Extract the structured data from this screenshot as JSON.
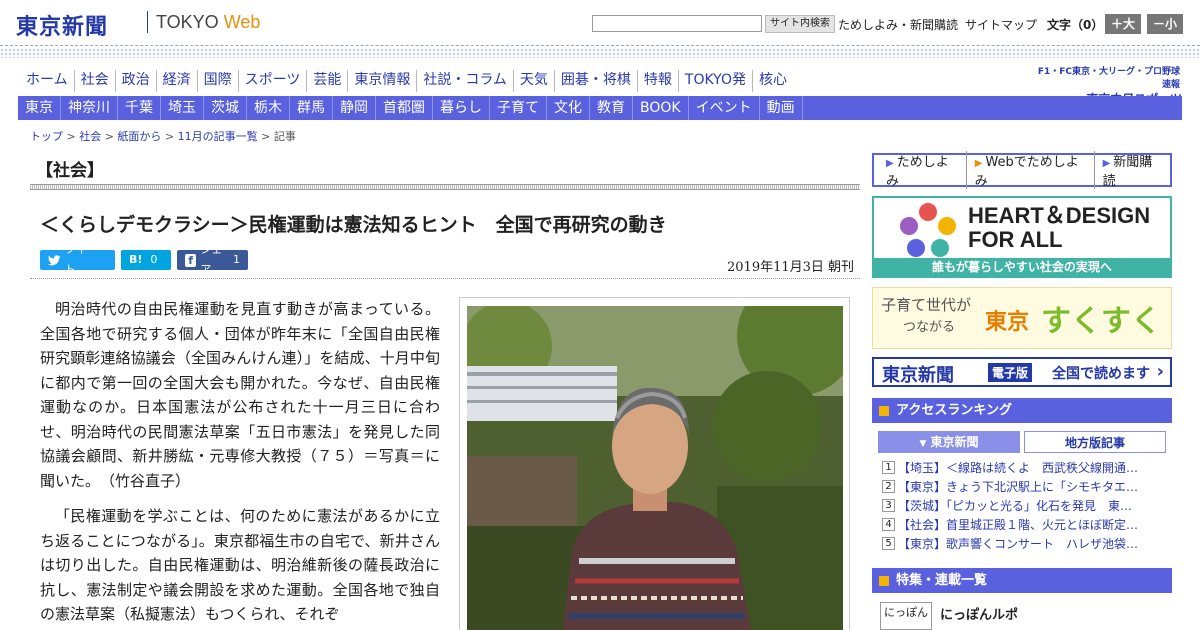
{
  "header": {
    "logo_jp": "東京新聞",
    "logo_en_tokyo": "TOKYO",
    "logo_en_web": "Web",
    "search_button": "サイト内検索",
    "search_value": "",
    "link_tameshi": "ためしよみ・新聞購読",
    "link_sitemap": "サイトマップ",
    "font_size_label": "文字（0）",
    "font_plus": "＋大",
    "font_minus": "－小"
  },
  "main_nav": [
    "ホーム",
    "社会",
    "政治",
    "経済",
    "国際",
    "スポーツ",
    "芸能",
    "東京情報",
    "社説・コラム",
    "天気",
    "囲碁・将棋",
    "特報",
    "TOKYO発",
    "核心"
  ],
  "chunichi": {
    "top": "F1・FC東京・大リーグ・プロ野球速報",
    "brand": "東京中日スポーツ"
  },
  "region_nav": [
    "東京",
    "神奈川",
    "千葉",
    "埼玉",
    "茨城",
    "栃木",
    "群馬",
    "静岡",
    "首都圏",
    "暮らし",
    "子育て",
    "文化",
    "教育",
    "BOOK",
    "イベント",
    "動画"
  ],
  "breadcrumb": [
    "トップ",
    "社会",
    "紙面から",
    "11月の記事一覧",
    "記事"
  ],
  "breadcrumb_sep": ">",
  "article": {
    "section": "【社会】",
    "title": "＜くらしデモクラシー＞民権運動は憲法知るヒント　全国で再研究の動き",
    "share_tweet": "ツイート",
    "share_hatena_logo": "B!",
    "share_hatena_count": "0",
    "share_fb_label": "シェア",
    "share_fb_count": "1",
    "date": "2019年11月3日 朝刊",
    "paragraphs": [
      "明治時代の自由民権運動を見直す動きが高まっている。全国各地で研究する個人・団体が昨年末に「全国自由民権研究顕彰連絡協議会（全国みんけん連）」を結成、十月中旬に都内で第一回の全国大会も開かれた。今なぜ、自由民権運動なのか。日本国憲法が公布された十一月三日に合わせ、明治時代の民間憲法草案「五日市憲法」を発見した同協議会顧問、新井勝紘・元専修大教授（７５）＝写真＝に聞いた。　（竹谷直子）",
      "「民権運動を学ぶことは、何のために憲法があるかに立ち返ることにつながる」。東京都福生市の自宅で、新井さんは切り出した。自由民権運動は、明治維新後の薩長政治に抗し、憲法制定や議会開設を求めた運動。全国各地で独自の憲法草案（私擬憲法）もつくられ、それぞ"
    ]
  },
  "sidebar": {
    "tameshi": [
      "ためしよみ",
      "Webでためしよみ",
      "新聞購読"
    ],
    "heart_design_line1": "HEART＆DESIGN",
    "heart_design_line2": "FOR ALL",
    "heart_design_sub": "誰もが暮らしやすい社会の実現へ",
    "sukusuku_1": "子育て世代が",
    "sukusuku_2": "つながる",
    "sukusuku_3": "東京",
    "sukusuku_4": "すくすく",
    "denshiban_1": "東京新聞",
    "denshiban_2": "電子版",
    "denshiban_3": "全国で読めます",
    "ranking_title": "アクセスランキング",
    "ranking_tab_active": "東京新聞",
    "ranking_tab_inactive": "地方版記事",
    "ranking": [
      {
        "num": "1",
        "text": "【埼玉】＜線路は続くよ　西武秩父線開通…"
      },
      {
        "num": "2",
        "text": "【東京】きょう下北沢駅上に「シモキタエ…"
      },
      {
        "num": "3",
        "text": "【茨城】「ピカッと光る」化石を発見　東…"
      },
      {
        "num": "4",
        "text": "【社会】首里城正殿１階、火元とほぼ断定…"
      },
      {
        "num": "5",
        "text": "【東京】歌声響くコンサート　ハレザ池袋…"
      }
    ],
    "tokushu_title": "特集・連載一覧",
    "tokushu_item": "にっぽんルポ",
    "tokushu_thumb": "にっぽん"
  },
  "colors": {
    "brand_blue": "#2438a6",
    "nav_bar": "#5961df",
    "twitter": "#1da1f2",
    "hatena": "#00a4de",
    "facebook": "#3b5998",
    "teal": "#3fb3a4"
  }
}
